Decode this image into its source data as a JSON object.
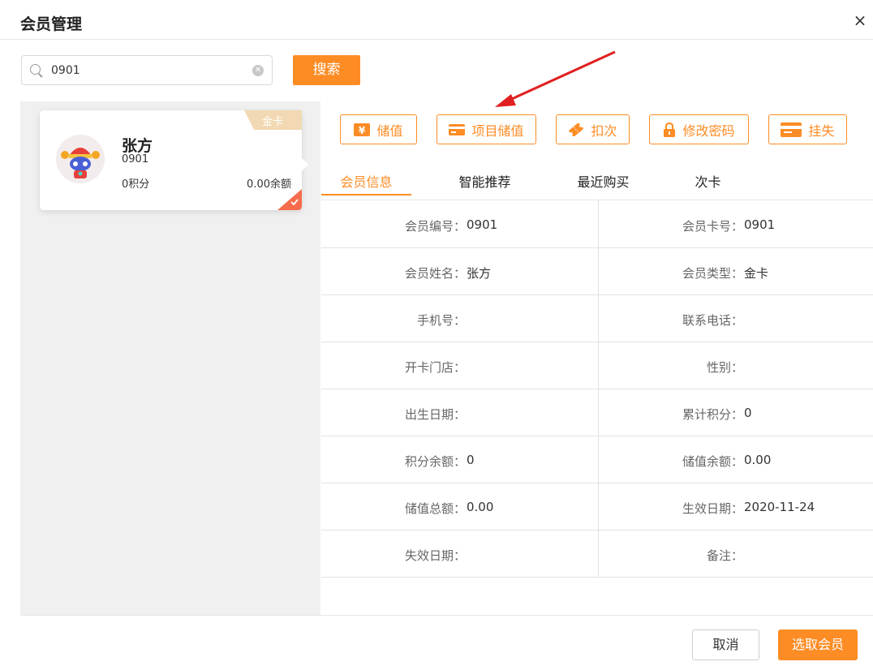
{
  "dialog": {
    "title": "会员管理",
    "close_glyph": "×"
  },
  "search": {
    "value": "0901",
    "button_label": "搜索"
  },
  "member_card": {
    "badge": "金卡",
    "name": "张方",
    "number": "0901",
    "points": "0积分",
    "balance": "0.00余额"
  },
  "actions": [
    {
      "label": "储值",
      "icon": "yen-icon"
    },
    {
      "label": "项目储值",
      "icon": "card-icon"
    },
    {
      "label": "扣次",
      "icon": "ticket-icon"
    },
    {
      "label": "修改密码",
      "icon": "lock-icon"
    },
    {
      "label": "挂失",
      "icon": "credit-card-icon"
    }
  ],
  "tabs": [
    "会员信息",
    "智能推荐",
    "最近购买",
    "次卡"
  ],
  "info_rows": [
    {
      "left_label": "会员编号：",
      "left_value": "0901",
      "right_label": "会员卡号：",
      "right_value": "0901"
    },
    {
      "left_label": "会员姓名：",
      "left_value": "张方",
      "right_label": "会员类型：",
      "right_value": "金卡"
    },
    {
      "left_label": "手机号：",
      "left_value": "",
      "right_label": "联系电话：",
      "right_value": ""
    },
    {
      "left_label": "开卡门店：",
      "left_value": "",
      "right_label": "性别：",
      "right_value": ""
    },
    {
      "left_label": "出生日期：",
      "left_value": "",
      "right_label": "累计积分：",
      "right_value": "0"
    },
    {
      "left_label": "积分余额：",
      "left_value": "0",
      "right_label": "储值余额：",
      "right_value": "0.00"
    },
    {
      "left_label": "储值总额：",
      "left_value": "0.00",
      "right_label": "生效日期：",
      "right_value": "2020-11-24"
    },
    {
      "left_label": "失效日期：",
      "left_value": "",
      "right_label": "备注：",
      "right_value": ""
    }
  ],
  "footer": {
    "cancel_label": "取消",
    "select_label": "选取会员"
  },
  "colors": {
    "accent": "#fd8c25",
    "badge": "#f2d9b3",
    "arrow": "#e02020"
  }
}
